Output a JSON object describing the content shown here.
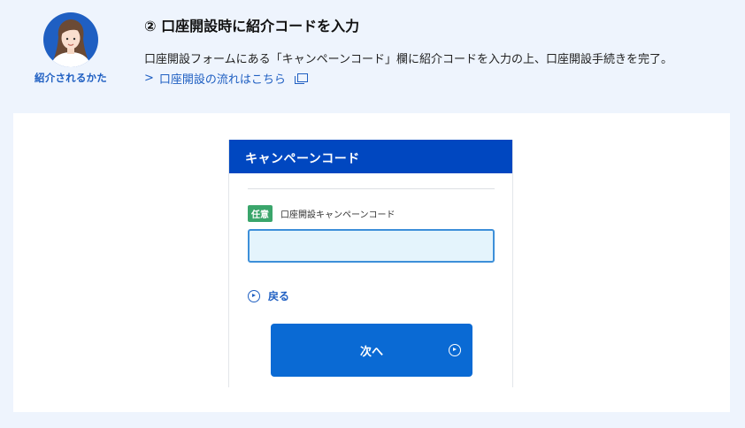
{
  "persona": {
    "label": "紹介されるかた"
  },
  "step": {
    "title": "② 口座開設時に紹介コードを入力",
    "description": "口座開設フォームにある「キャンペーンコード」欄に紹介コードを入力の上、口座開設手続きを完了。",
    "link_label": "口座開設の流れはこちら",
    "link_icon": "external-window-icon"
  },
  "form": {
    "header": "キャンペーンコード",
    "badge": "任意",
    "field_label": "口座開設キャンペーンコード",
    "input_value": "",
    "back_label": "戻る",
    "next_label": "次へ"
  },
  "colors": {
    "page_bg": "#eef4fd",
    "header_blue": "#0047c0",
    "button_blue": "#0a6ad4",
    "link_blue": "#1f5fc2",
    "badge_green": "#3aa56b",
    "input_bg": "#e4f4fc"
  }
}
